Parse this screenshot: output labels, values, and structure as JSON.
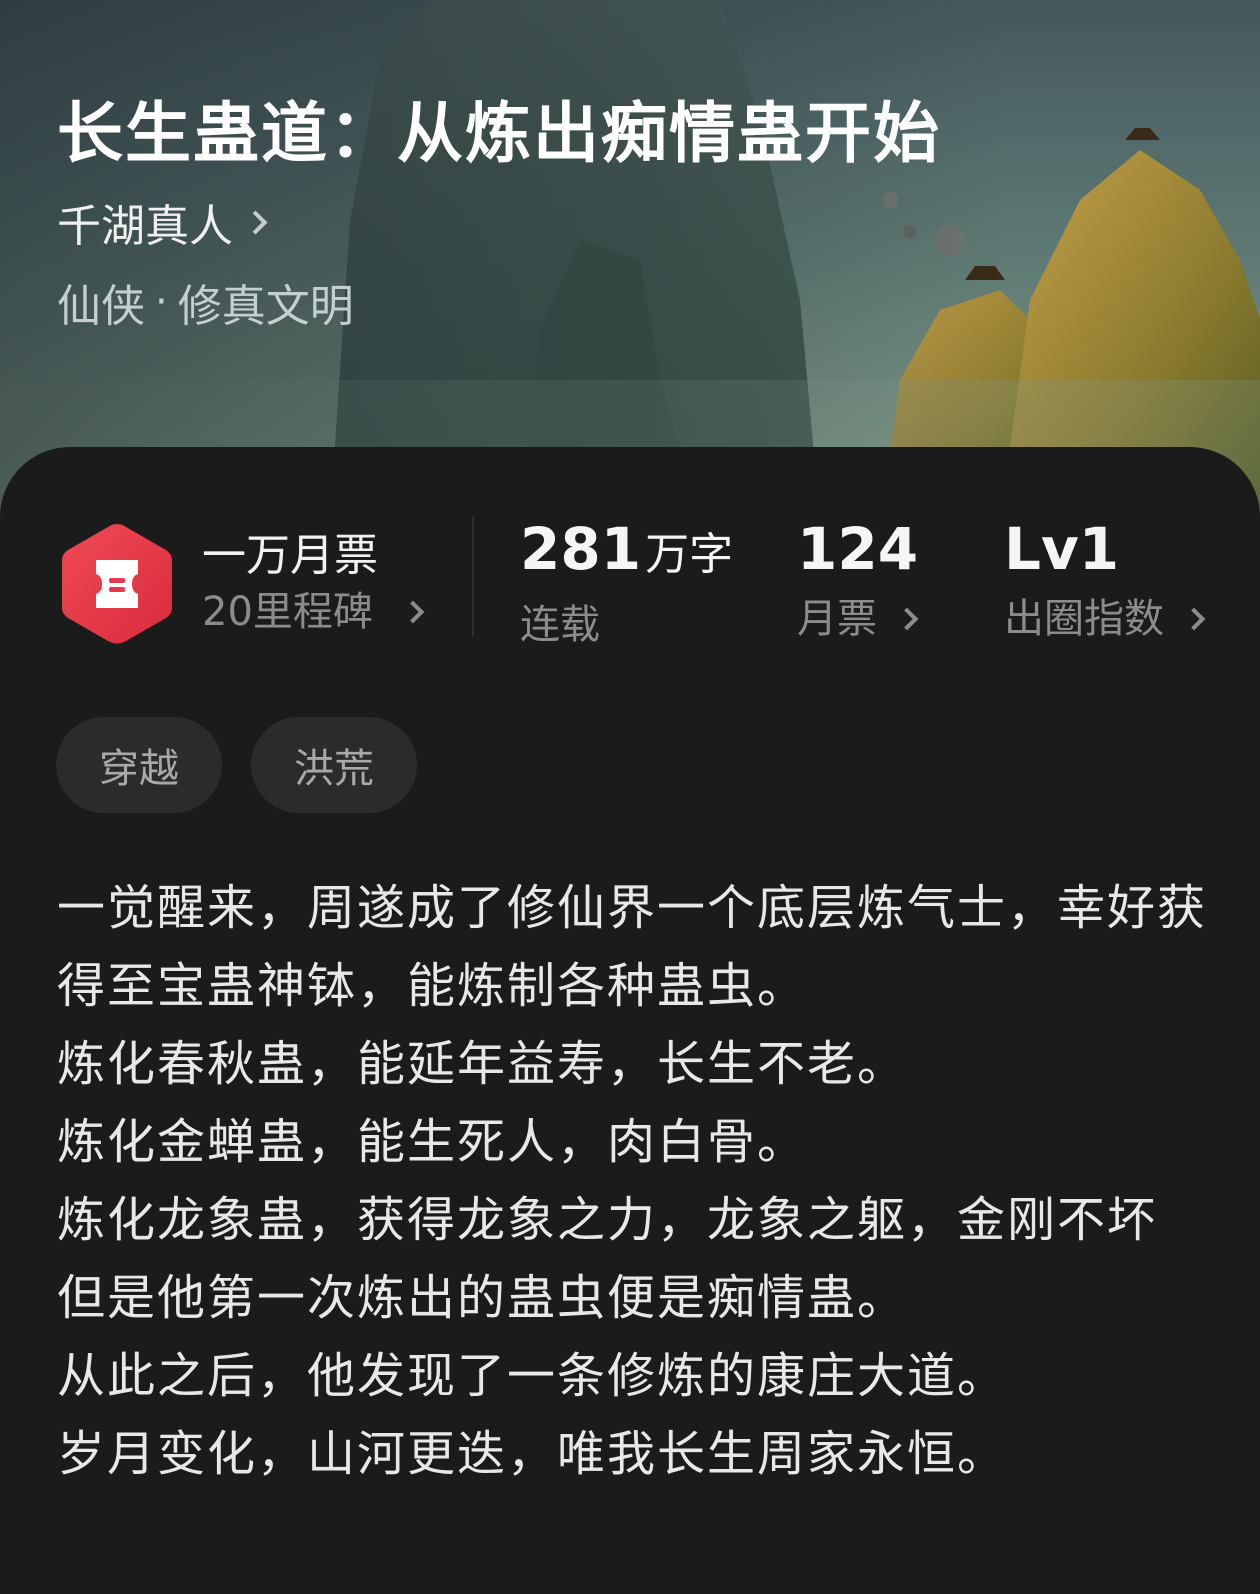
{
  "book": {
    "title": "长生蛊道：从炼出痴情蛊开始",
    "author": "千湖真人",
    "genre": {
      "category": "仙侠",
      "separator": "·",
      "subcategory": "修真文明"
    }
  },
  "stats": {
    "ticket": {
      "title": "一万月票",
      "subtitle": "20里程碑",
      "icon": "ticket-hexagon-icon",
      "icon_color": "#e8394a"
    },
    "words": {
      "value": "281",
      "unit": "万字",
      "label": "连载"
    },
    "votes": {
      "value": "124",
      "label": "月票"
    },
    "index": {
      "value": "Lv1",
      "label": "出圈指数"
    }
  },
  "tags": [
    "穿越",
    "洪荒"
  ],
  "synopsis": [
    "一觉醒来，周遂成了修仙界一个底层炼气士，幸好获得至宝蛊神钵，能炼制各种蛊虫。",
    "炼化春秋蛊，能延年益寿，长生不老。",
    "炼化金蝉蛊，能生死人，肉白骨。",
    "炼化龙象蛊，获得龙象之力，龙象之躯，金刚不坏",
    "但是他第一次炼出的蛊虫便是痴情蛊。",
    "从此之后，他发现了一条修炼的康庄大道。",
    "岁月变化，山河更迭，唯我长生周家永恒。"
  ]
}
